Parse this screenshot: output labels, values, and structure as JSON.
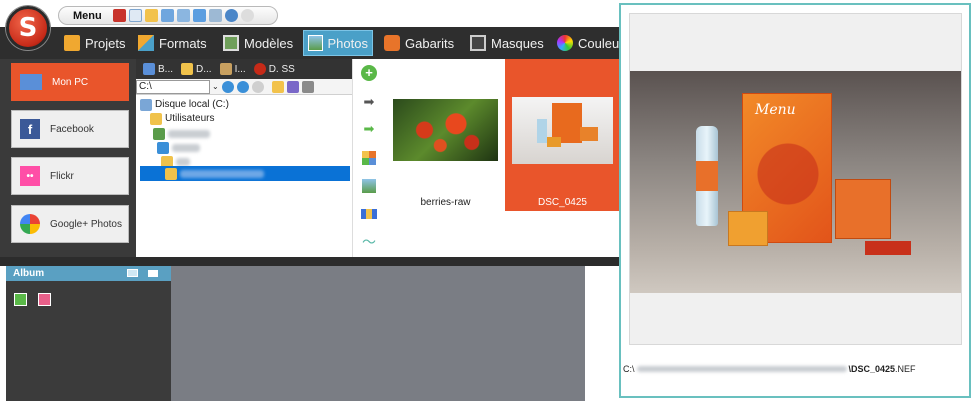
{
  "topbar": {
    "logo_letter": "S",
    "menu_label": "Menu"
  },
  "tabs": [
    {
      "label": "Projets",
      "icon": "folder-icon"
    },
    {
      "label": "Formats",
      "icon": "formats-icon"
    },
    {
      "label": "Modèles",
      "icon": "templates-icon"
    },
    {
      "label": "Photos",
      "icon": "photos-icon",
      "active": true
    },
    {
      "label": "Gabarits",
      "icon": "puzzle-icon"
    },
    {
      "label": "Masques",
      "icon": "mask-icon"
    },
    {
      "label": "Couleu",
      "icon": "color-wheel-icon"
    }
  ],
  "sources": [
    {
      "label": "Mon PC",
      "active": true
    },
    {
      "label": "Facebook"
    },
    {
      "label": "Flickr"
    },
    {
      "label": "Google+ Photos"
    }
  ],
  "tree": {
    "tabs": [
      "B...",
      "D...",
      "I...",
      "D. SS"
    ],
    "path": "C:\\",
    "drive_label": "Disque local (C:)",
    "users_label": "Utilisateurs"
  },
  "thumbnails": [
    {
      "label": "berries-raw"
    },
    {
      "label": "DSC_0425",
      "selected": true
    }
  ],
  "album": {
    "title": "Album"
  },
  "preview": {
    "path_prefix": "C:\\",
    "path_file": "\\DSC_0425",
    "path_ext": ".NEF",
    "menu_card_title": "Menu"
  },
  "colors": {
    "accent_orange": "#e9552b",
    "active_tab_blue": "#4aa0c8",
    "album_header": "#5aa0c2",
    "preview_border": "#69c0bf",
    "selection_blue": "#0a72d6"
  }
}
